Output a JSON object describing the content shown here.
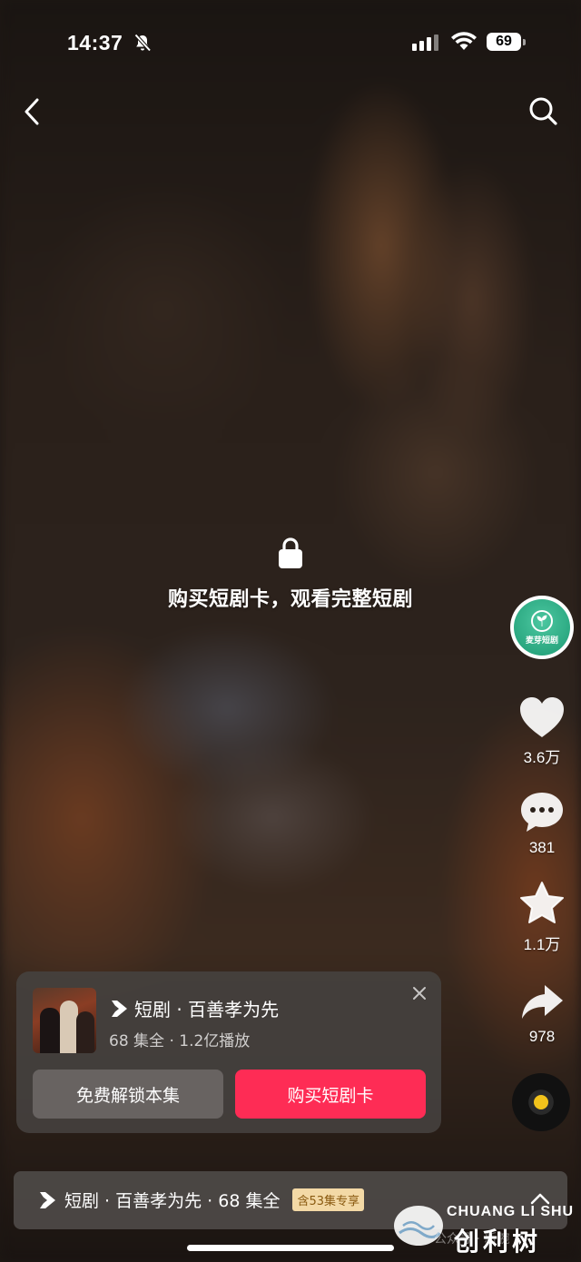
{
  "status_bar": {
    "time": "14:37",
    "battery": "69",
    "icons": [
      "bell-muted-icon",
      "cellular-signal-icon",
      "wifi-icon",
      "battery-icon"
    ]
  },
  "nav": {
    "back_icon": "chevron-left-icon",
    "search_icon": "search-icon"
  },
  "lock_overlay": {
    "icon": "lock-icon",
    "message": "购买短剧卡，观看完整短剧"
  },
  "creator": {
    "avatar_label": "麦芽短剧"
  },
  "actions": {
    "likes": "3.6万",
    "comments": "381",
    "favorites": "1.1万",
    "shares": "978"
  },
  "drama_card": {
    "title": "短剧 · 百善孝为先",
    "subtitle": "68 集全 · 1.2亿播放",
    "free_unlock_label": "免费解锁本集",
    "buy_label": "购买短剧卡"
  },
  "bottom_bar": {
    "text": "短剧 · 百善孝为先 · 68 集全",
    "badge": "含53集专享"
  },
  "watermark": {
    "en": "CHUANG LI SHU",
    "sub": "公众号 · 新腕",
    "cn": "创利树"
  },
  "colors": {
    "accent": "#fe2c55",
    "badge_bg": "#f3d9a6",
    "disc_dot": "#f1c21b"
  }
}
